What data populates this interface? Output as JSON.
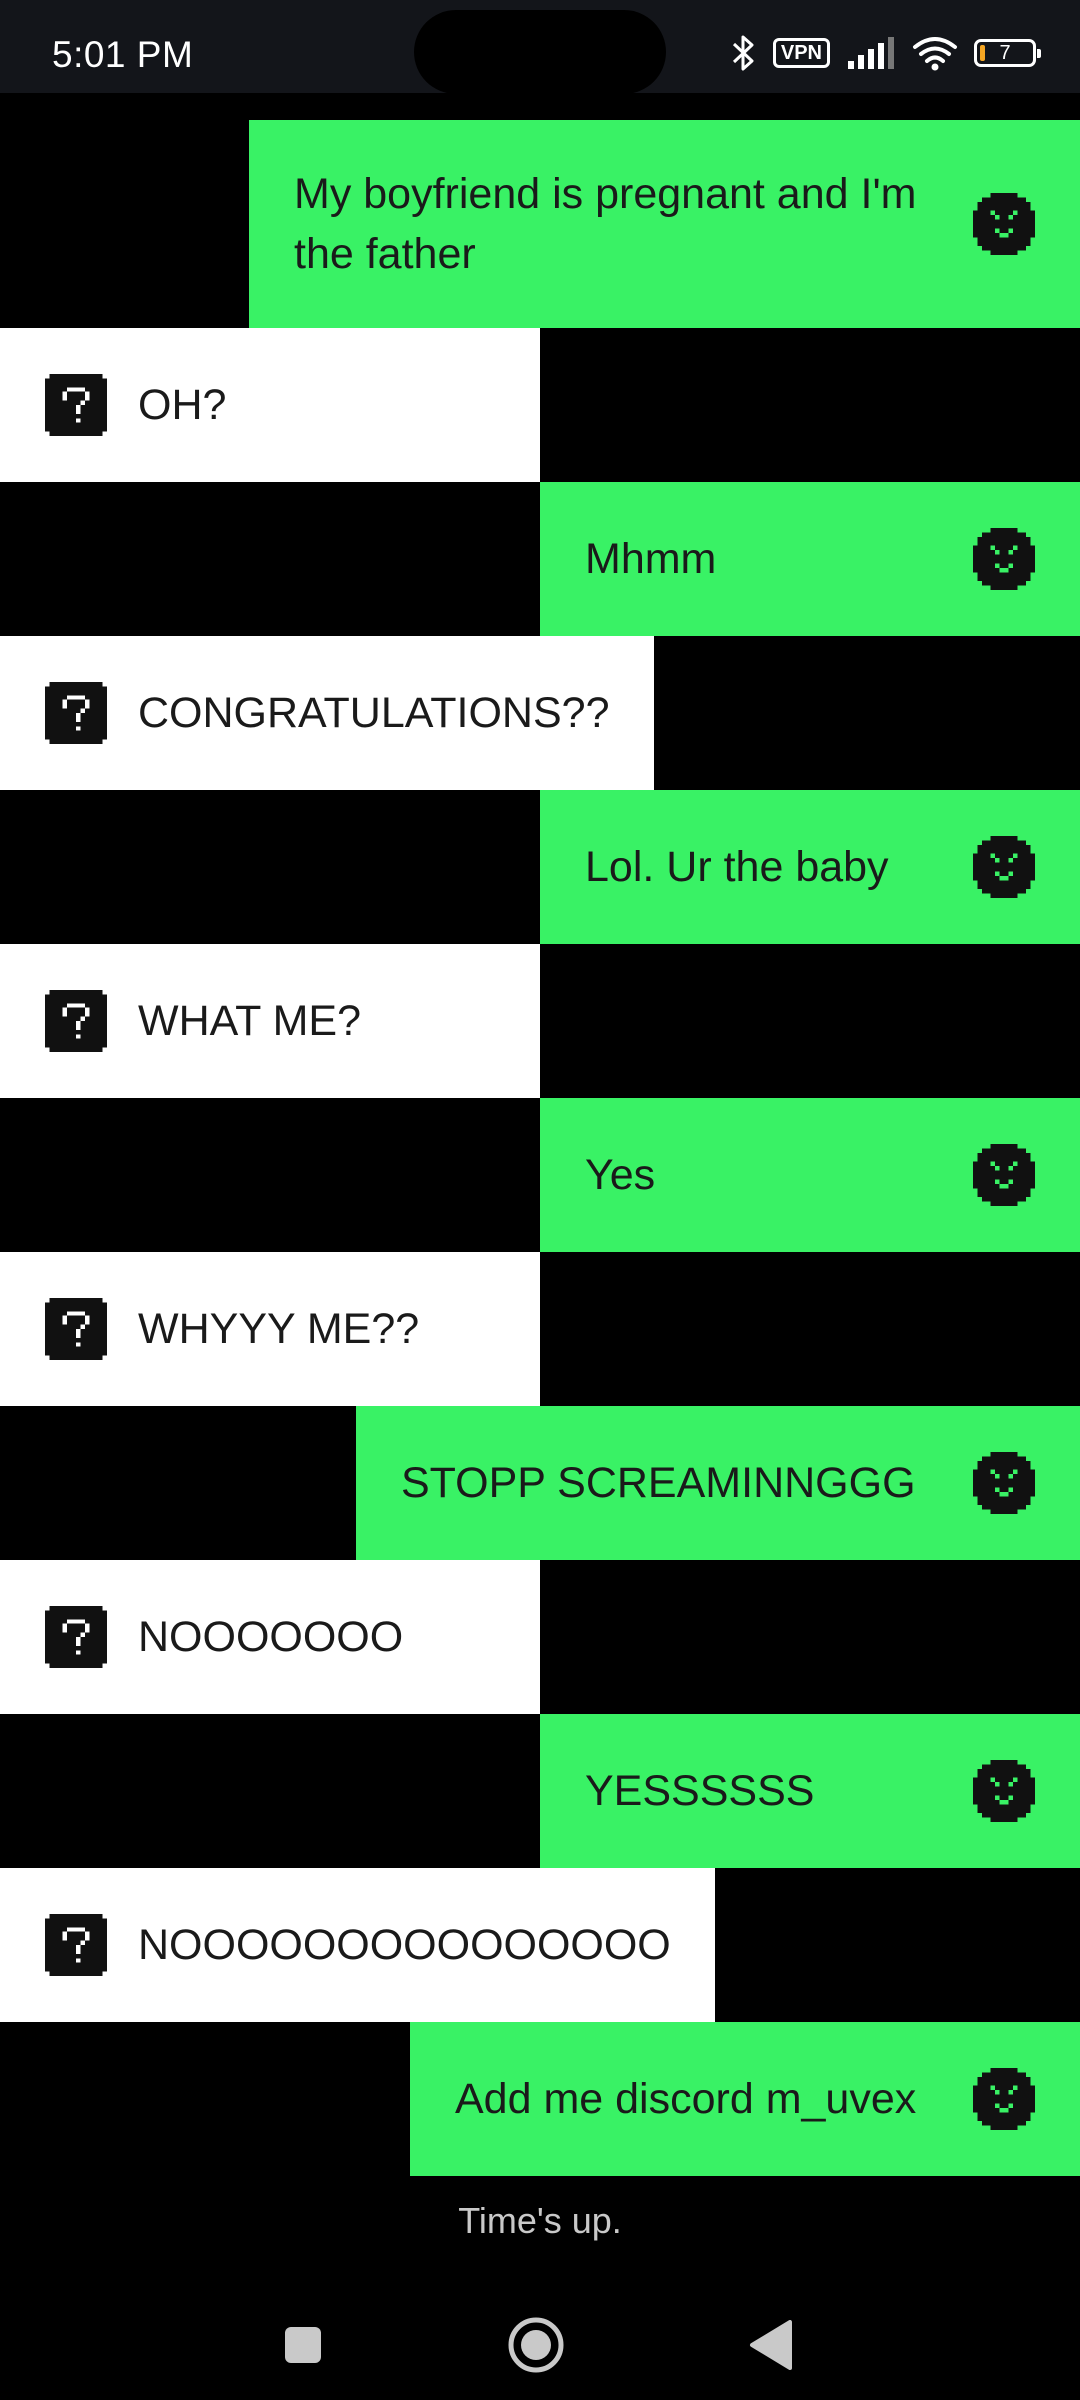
{
  "status_bar": {
    "time": "5:01 PM",
    "vpn_label": "VPN",
    "battery_level": "7",
    "icons": [
      "bluetooth-icon",
      "vpn-icon",
      "signal-icon",
      "wifi-icon",
      "battery-icon"
    ]
  },
  "messages": [
    {
      "sender": "self",
      "text": "My boyfriend is pregnant and I'm\nthe father"
    },
    {
      "sender": "other",
      "text": "OH?"
    },
    {
      "sender": "self",
      "text": "Mhmm"
    },
    {
      "sender": "other",
      "text": "CONGRATULATIONS??"
    },
    {
      "sender": "self",
      "text": "Lol. Ur the baby"
    },
    {
      "sender": "other",
      "text": "WHAT ME?"
    },
    {
      "sender": "self",
      "text": "Yes"
    },
    {
      "sender": "other",
      "text": "WHYYY ME??"
    },
    {
      "sender": "self",
      "text": "STOPP SCREAMINNGGG"
    },
    {
      "sender": "other",
      "text": "NOOOOOOO"
    },
    {
      "sender": "self",
      "text": "YESSSSSS"
    },
    {
      "sender": "other",
      "text": "NOOOOOOOOOOOOOOO"
    },
    {
      "sender": "self",
      "text": "Add me discord m_uvex"
    }
  ],
  "footer": {
    "status_text": "Time's up."
  },
  "colors": {
    "self_bubble": "#39f265",
    "other_bubble": "#ffffff",
    "background": "#000000",
    "status_bar": "#13151a"
  }
}
